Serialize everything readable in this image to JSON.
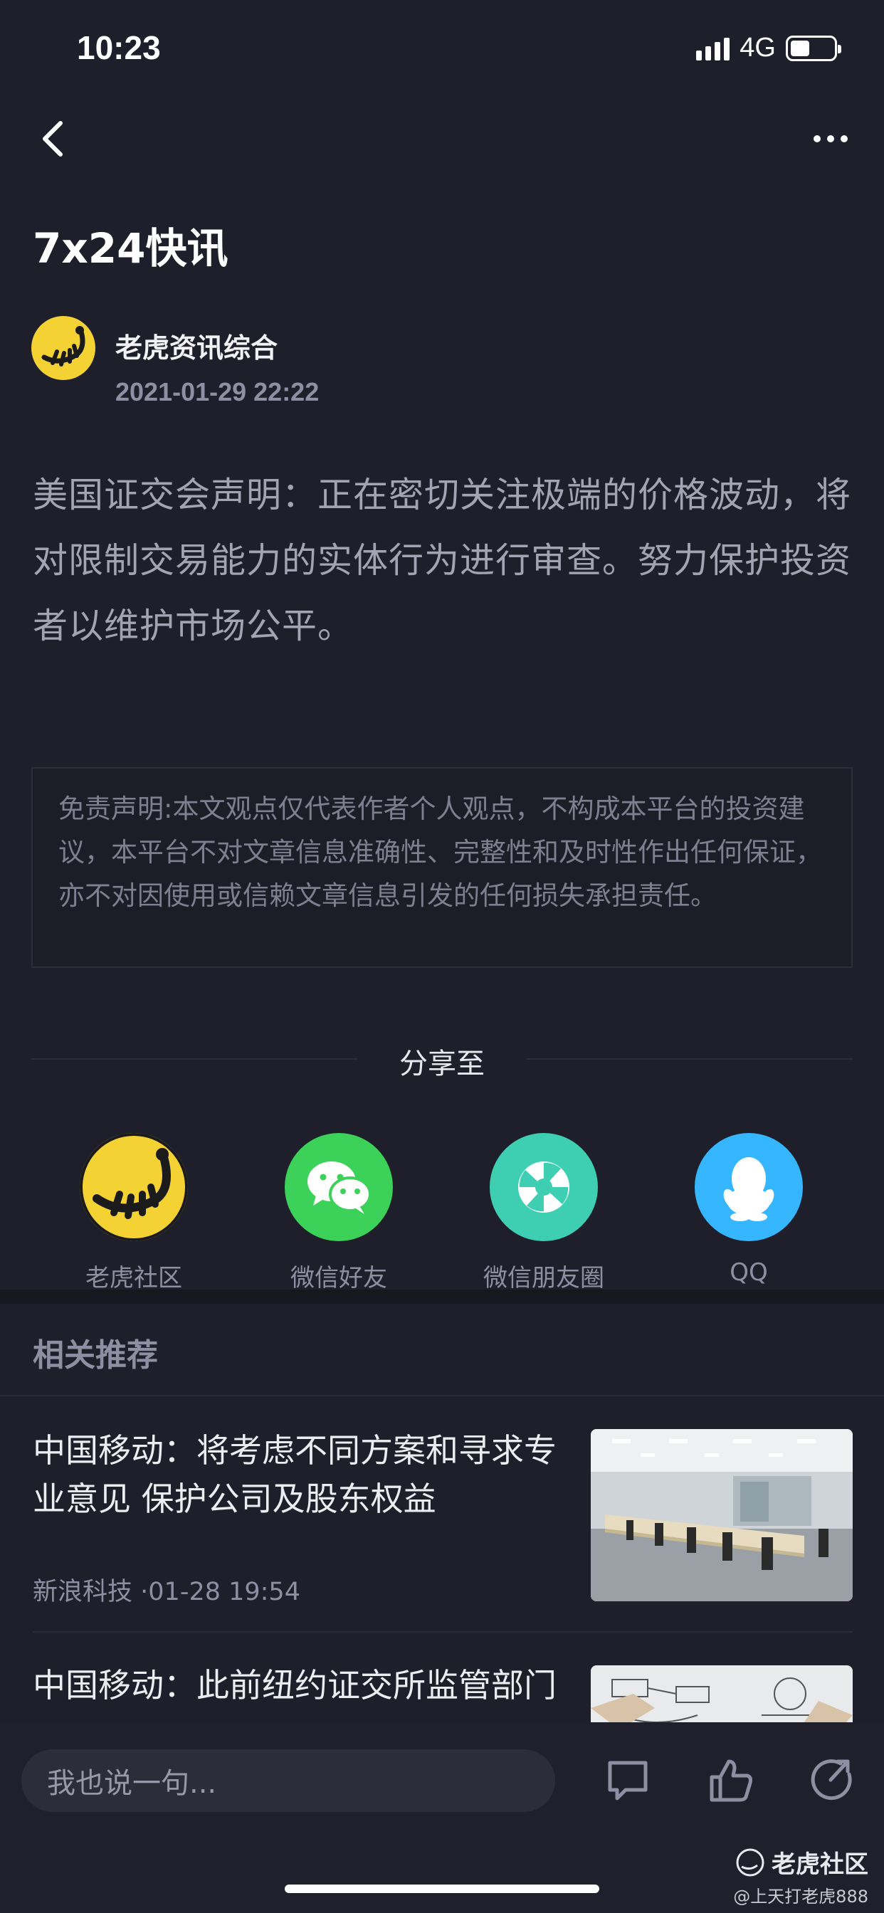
{
  "status_bar": {
    "time": "10:23",
    "network": "4G"
  },
  "header": {
    "title": "7x24快讯"
  },
  "author": {
    "name": "老虎资讯综合",
    "datetime": "2021-01-29 22:22"
  },
  "article": {
    "body": "美国证交会声明：正在密切关注极端的价格波动，将对限制交易能力的实体行为进行审查。努力保护投资者以维护市场公平。"
  },
  "disclaimer": {
    "text": "免责声明:本文观点仅代表作者个人观点，不构成本平台的投资建议，本平台不对文章信息准确性、完整性和及时性作出任何保证，亦不对因使用或信赖文章信息引发的任何损失承担责任。"
  },
  "share": {
    "title": "分享至",
    "targets": [
      {
        "label": "老虎社区",
        "icon": "tiger-community-icon",
        "color": "#f5d233"
      },
      {
        "label": "微信好友",
        "icon": "wechat-icon",
        "color": "#3cd158"
      },
      {
        "label": "微信朋友圈",
        "icon": "moments-icon",
        "color": "#3ecfb2"
      },
      {
        "label": "QQ",
        "icon": "qq-icon",
        "color": "#35b6ff"
      }
    ]
  },
  "related": {
    "title": "相关推荐",
    "items": [
      {
        "title": "中国移动：将考虑不同方案和寻求专业意见 保护公司及股东权益",
        "source": "新浪科技",
        "time": "·01-28 19:54",
        "thumb": "office-photo"
      },
      {
        "title": "中国移动：此前纽约证交所监管部门",
        "thumb": "business-sketch-photo"
      }
    ]
  },
  "bottom_bar": {
    "comment_placeholder": "我也说一句..."
  },
  "watermark": {
    "brand": "老虎社区",
    "user": "@上天打老虎888"
  },
  "colors": {
    "background": "#1e1f2a",
    "accent_yellow": "#f5d233",
    "muted_text": "#8e8fa3"
  }
}
